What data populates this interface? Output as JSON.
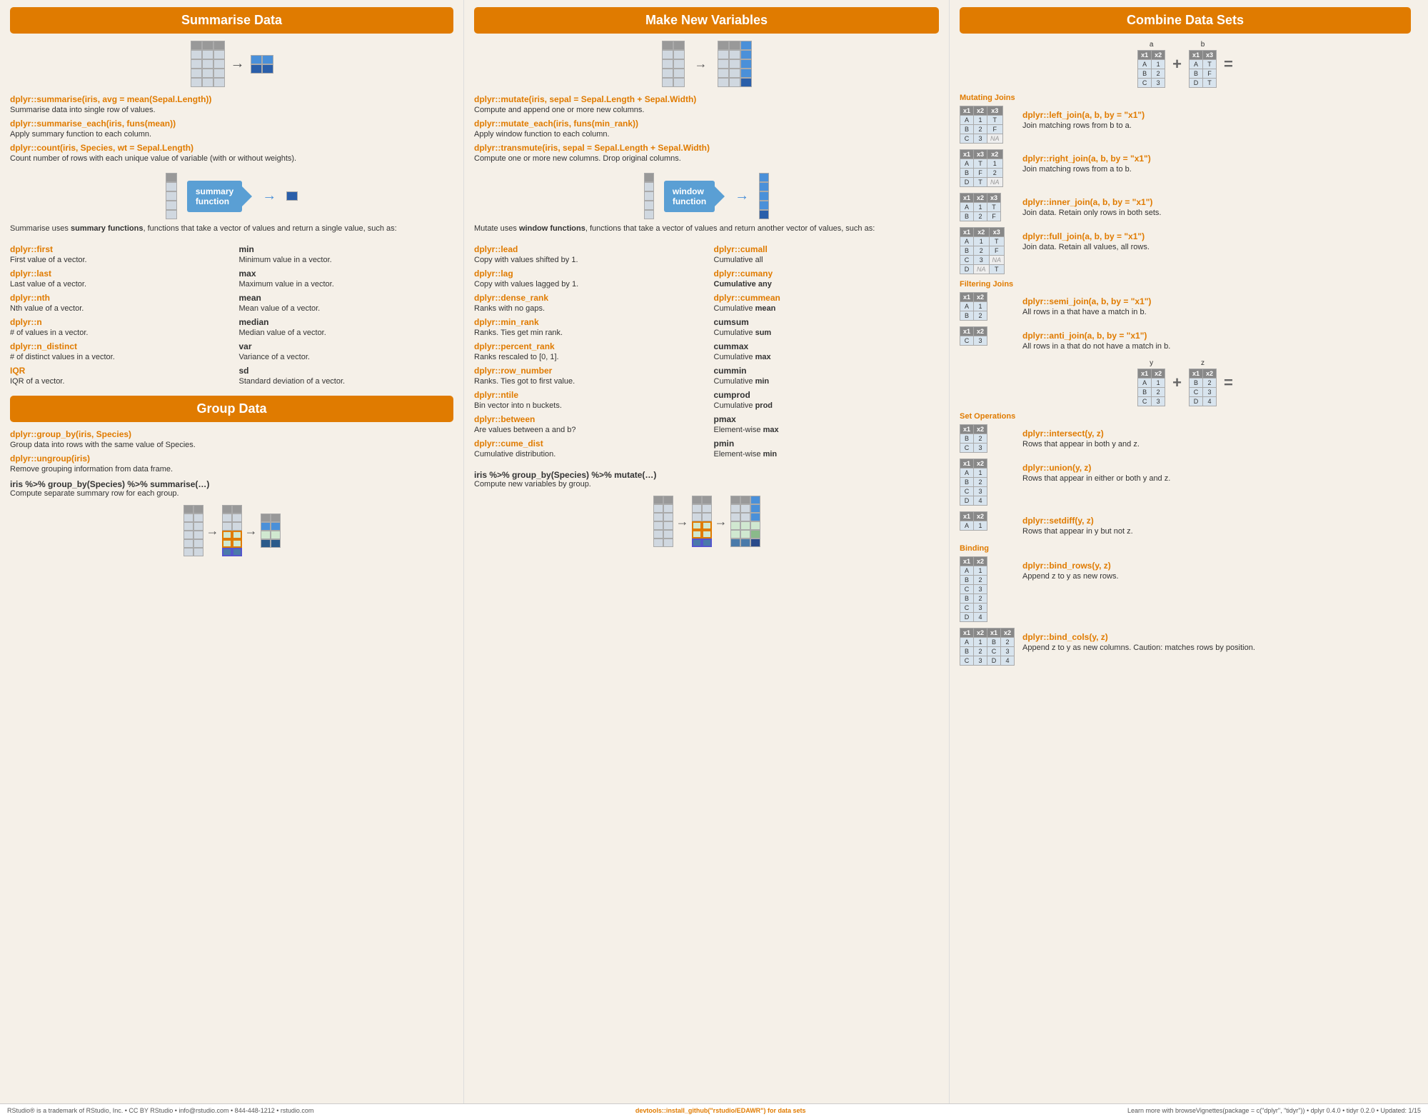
{
  "sections": {
    "summarise": {
      "title": "Summarise Data",
      "commands": [
        {
          "code": "dplyr::summarise(iris, avg = mean(Sepal.Length))",
          "desc": "Summarise data into single row of values."
        },
        {
          "code": "dplyr::summarise_each(iris, funs(mean))",
          "desc": "Apply summary function to each column."
        },
        {
          "code": "dplyr::count(iris, Species, wt = Sepal.Length)",
          "desc": "Count number of rows with each unique value of variable (with or without weights)."
        }
      ],
      "summary_box": "summary\nfunction",
      "summary_para": "Summarise uses summary functions, functions that take a vector of values and return a single value, such as:",
      "left_funcs": [
        {
          "code": "dplyr::first",
          "desc": "First value of a vector."
        },
        {
          "code": "dplyr::last",
          "desc": "Last value of a vector."
        },
        {
          "code": "dplyr::nth",
          "desc": "Nth value of a vector."
        },
        {
          "code": "dplyr::n",
          "desc": "# of values in a vector."
        },
        {
          "code": "dplyr::n_distinct",
          "desc": "# of distinct values in a vector."
        },
        {
          "code": "IQR",
          "desc": "IQR of a vector."
        }
      ],
      "right_funcs": [
        {
          "code": "min",
          "desc": "Minimum value in a vector."
        },
        {
          "code": "max",
          "desc": "Maximum value in a vector."
        },
        {
          "code": "mean",
          "desc": "Mean value of a vector."
        },
        {
          "code": "median",
          "desc": "Median value of a vector."
        },
        {
          "code": "var",
          "desc": "Variance of a vector."
        },
        {
          "code": "sd",
          "desc": "Standard deviation of a vector."
        }
      ]
    },
    "group_data": {
      "title": "Group Data",
      "commands": [
        {
          "code": "dplyr::group_by(iris, Species)",
          "desc": "Group data into rows with the same value of Species."
        },
        {
          "code": "dplyr::ungroup(iris)",
          "desc": "Remove grouping information from data frame."
        }
      ],
      "pipeline": "iris %>% group_by(Species) %>% summarise(…)",
      "pipeline_desc": "Compute separate summary row for each group."
    },
    "make_new": {
      "title": "Make New Variables",
      "commands": [
        {
          "code": "dplyr::mutate(iris, sepal = Sepal.Length + Sepal.Width)",
          "desc": "Compute and append one or more new columns."
        },
        {
          "code": "dplyr::mutate_each(iris, funs(min_rank))",
          "desc": "Apply window function to each column."
        },
        {
          "code": "dplyr::transmute(iris, sepal = Sepal.Length + Sepal.Width)",
          "desc": "Compute one or more new columns. Drop original columns."
        }
      ],
      "window_box": "window\nfunction",
      "window_para": "Mutate uses window functions, functions that take a vector of values and return another vector of values, such as:",
      "left_funcs": [
        {
          "code": "dplyr::lead",
          "desc": "Copy with values shifted by 1."
        },
        {
          "code": "dplyr::lag",
          "desc": "Copy with values lagged by 1."
        },
        {
          "code": "dplyr::dense_rank",
          "desc": "Ranks with no gaps."
        },
        {
          "code": "dplyr::min_rank",
          "desc": "Ranks. Ties get min rank."
        },
        {
          "code": "dplyr::percent_rank",
          "desc": "Ranks rescaled to [0, 1]."
        },
        {
          "code": "dplyr::row_number",
          "desc": "Ranks. Ties got to first value."
        },
        {
          "code": "dplyr::ntile",
          "desc": "Bin vector into n buckets."
        },
        {
          "code": "dplyr::between",
          "desc": "Are values between a and b?"
        },
        {
          "code": "dplyr::cume_dist",
          "desc": "Cumulative distribution."
        }
      ],
      "right_funcs": [
        {
          "code": "dplyr::cumall",
          "desc": "Cumulative all"
        },
        {
          "code": "dplyr::cumany",
          "desc": "Cumulative any"
        },
        {
          "code": "dplyr::cummean",
          "desc": "Cumulative mean"
        },
        {
          "code": "cumsum",
          "desc": "Cumulative sum"
        },
        {
          "code": "cummax",
          "desc": "Cumulative max"
        },
        {
          "code": "cummin",
          "desc": "Cumulative min"
        },
        {
          "code": "cumprod",
          "desc": "Cumulative prod"
        },
        {
          "code": "pmax",
          "desc": "Element-wise max"
        },
        {
          "code": "pmin",
          "desc": "Element-wise min"
        }
      ],
      "pipeline": "iris %>% group_by(Species) %>% mutate(…)",
      "pipeline_desc": "Compute new variables by group."
    },
    "combine": {
      "title": "Combine Data Sets",
      "mutating_joins_label": "Mutating Joins",
      "filtering_joins_label": "Filtering Joins",
      "set_ops_label": "Set Operations",
      "binding_label": "Binding",
      "joins": [
        {
          "code": "dplyr::left_join(a, b, by = \"x1\")",
          "desc": "Join matching rows from b to a."
        },
        {
          "code": "dplyr::right_join(a, b, by = \"x1\")",
          "desc": "Join matching rows from a to b."
        },
        {
          "code": "dplyr::inner_join(a, b, by = \"x1\")",
          "desc": "Join data. Retain only rows in both sets."
        },
        {
          "code": "dplyr::full_join(a, b, by = \"x1\")",
          "desc": "Join data. Retain all values, all rows."
        }
      ],
      "filter_joins": [
        {
          "code": "dplyr::semi_join(a, b, by = \"x1\")",
          "desc": "All rows in a that have a match in b."
        },
        {
          "code": "dplyr::anti_join(a, b, by = \"x1\")",
          "desc": "All rows in a that do not have a match in b."
        }
      ],
      "set_ops": [
        {
          "code": "dplyr::intersect(y, z)",
          "desc": "Rows that appear in both y and z."
        },
        {
          "code": "dplyr::union(y, z)",
          "desc": "Rows that appear in either or both y and z."
        },
        {
          "code": "dplyr::setdiff(y, z)",
          "desc": "Rows that appear in y but not z."
        }
      ],
      "bindings": [
        {
          "code": "dplyr::bind_rows(y, z)",
          "desc": "Append z to y as new rows."
        },
        {
          "code": "dplyr::bind_cols(y, z)",
          "desc": "Append z to y as new columns. Caution: matches rows by position."
        }
      ]
    }
  },
  "footer": {
    "left": "RStudio® is a trademark of RStudio, Inc. • CC BY RStudio • info@rstudio.com • 844-448-1212 • rstudio.com",
    "center": "devtools::install_github(\"rstudio/EDAWR\") for data sets",
    "right": "Learn more with browseVignettes(package = c(\"dplyr\", \"tidyr\")) • dplyr 0.4.0 • tidyr 0.2.0 • Updated: 1/15"
  }
}
